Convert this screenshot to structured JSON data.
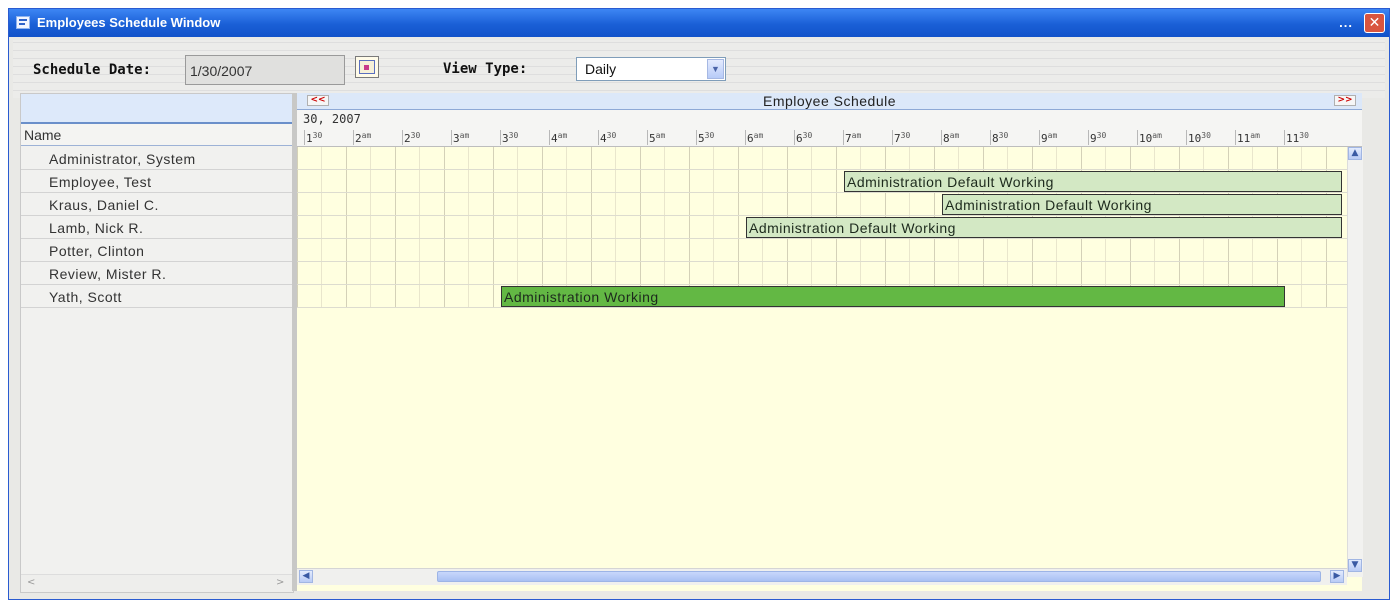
{
  "window": {
    "title": "Employees Schedule Window",
    "title_dots": "...",
    "close": "✕"
  },
  "toolbar": {
    "schedule_date_label": "Schedule Date:",
    "schedule_date_value": "1/30/2007",
    "view_type_label": "View Type:",
    "view_type_value": "Daily"
  },
  "left": {
    "column_header": "Name",
    "employees": [
      "Administrator, System",
      "Employee, Test",
      "Kraus, Daniel C.",
      "Lamb, Nick R.",
      "Potter, Clinton",
      "Review, Mister R.",
      "Yath, Scott"
    ]
  },
  "schedule": {
    "title": "Employee Schedule",
    "prev": "<<",
    "next": ">>",
    "date_label": "30, 2007",
    "ticks": [
      {
        "h": "1",
        "s": "30"
      },
      {
        "h": "2",
        "s": "am"
      },
      {
        "h": "2",
        "s": "30"
      },
      {
        "h": "3",
        "s": "am"
      },
      {
        "h": "3",
        "s": "30"
      },
      {
        "h": "4",
        "s": "am"
      },
      {
        "h": "4",
        "s": "30"
      },
      {
        "h": "5",
        "s": "am"
      },
      {
        "h": "5",
        "s": "30"
      },
      {
        "h": "6",
        "s": "am"
      },
      {
        "h": "6",
        "s": "30"
      },
      {
        "h": "7",
        "s": "am"
      },
      {
        "h": "7",
        "s": "30"
      },
      {
        "h": "8",
        "s": "am"
      },
      {
        "h": "8",
        "s": "30"
      },
      {
        "h": "9",
        "s": "am"
      },
      {
        "h": "9",
        "s": "30"
      },
      {
        "h": "10",
        "s": "am"
      },
      {
        "h": "10",
        "s": "30"
      },
      {
        "h": "11",
        "s": "am"
      },
      {
        "h": "11",
        "s": "30"
      }
    ],
    "bars": [
      {
        "row": 1,
        "label": "Administration Default Working",
        "start": "7am",
        "end": "beyond 11:30",
        "color": "#d3e8c4"
      },
      {
        "row": 2,
        "label": "Administration Default Working",
        "start": "8am",
        "end": "beyond 11:30",
        "color": "#d3e8c4"
      },
      {
        "row": 3,
        "label": "Administration Default Working",
        "start": "6am",
        "end": "beyond 11:30",
        "color": "#d3e8c4"
      },
      {
        "row": 6,
        "label": "Administration Working",
        "start": "3:30am",
        "end": "11:30am",
        "color": "#63b844"
      }
    ]
  }
}
